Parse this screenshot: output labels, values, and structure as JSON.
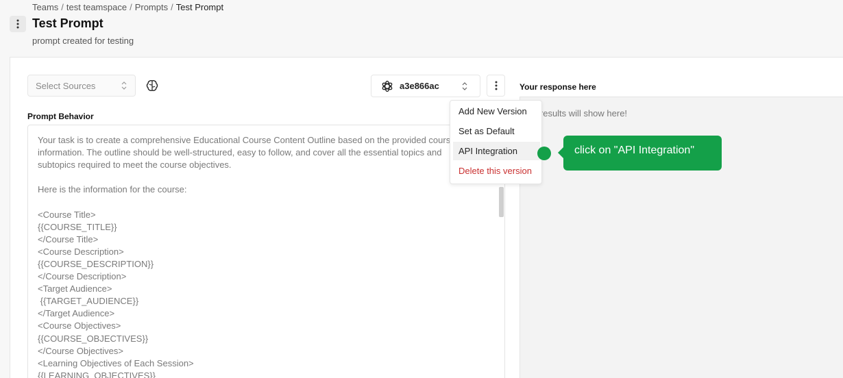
{
  "breadcrumb": {
    "items": [
      "Teams",
      "test teamspace",
      "Prompts",
      "Test Prompt"
    ],
    "separator": "/"
  },
  "header": {
    "title": "Test Prompt",
    "subtitle": "prompt created for testing"
  },
  "toolbar": {
    "sources_placeholder": "Select Sources",
    "model_version": "a3e866ac"
  },
  "prompt": {
    "label": "Prompt Behavior",
    "text": "Your task is to create a comprehensive Educational Course Content Outline based on the provided course\ninformation. The outline should be well-structured, easy to follow, and cover all the essential topics and\nsubtopics required to meet the course objectives.\n\nHere is the information for the course:\n\n<Course Title>\n{{COURSE_TITLE}}\n</Course Title>\n<Course Description>\n{{COURSE_DESCRIPTION}}\n</Course Description>\n<Target Audience>\n {{TARGET_AUDIENCE}}\n</Target Audience>\n<Course Objectives>\n{{COURSE_OBJECTIVES}}\n</Course Objectives>\n<Learning Objectives of Each Session>\n{{LEARNING_OBJECTIVES}}"
  },
  "response": {
    "title": "Your response here",
    "placeholder": "Your results will show here!"
  },
  "dropdown": {
    "items": [
      "Add New Version",
      "Set as Default",
      "API Integration",
      "Delete this version"
    ],
    "highlighted": "API Integration",
    "danger_color": "#c93030"
  },
  "hint": {
    "text": "click on \"API Integration\"",
    "color": "#14a049"
  }
}
